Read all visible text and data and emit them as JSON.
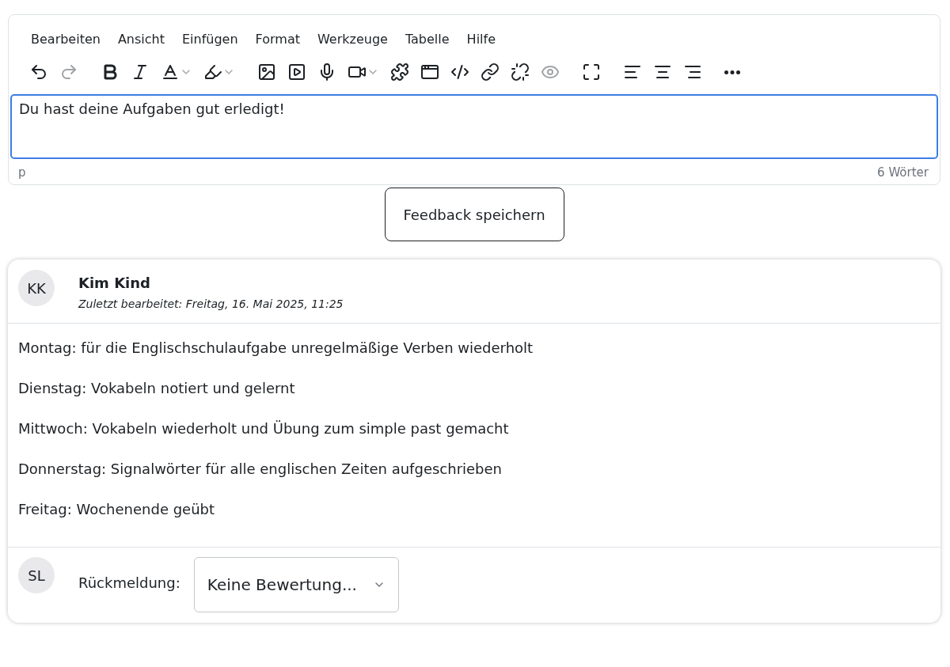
{
  "editor": {
    "menu": [
      "Bearbeiten",
      "Ansicht",
      "Einfügen",
      "Format",
      "Werkzeuge",
      "Tabelle",
      "Hilfe"
    ],
    "toolbar": [
      [
        {
          "kind": "undo",
          "disabled": false
        },
        {
          "kind": "redo",
          "disabled": true
        }
      ],
      [
        {
          "kind": "bold",
          "disabled": false
        },
        {
          "kind": "italic",
          "disabled": false
        },
        {
          "kind": "textcolor",
          "disabled": false
        },
        {
          "kind": "highlight",
          "disabled": false
        }
      ],
      [
        {
          "kind": "image",
          "disabled": false
        },
        {
          "kind": "media",
          "disabled": false
        },
        {
          "kind": "mic",
          "disabled": false
        },
        {
          "kind": "video",
          "disabled": false
        },
        {
          "kind": "plugin",
          "disabled": false
        },
        {
          "kind": "embed",
          "disabled": false
        },
        {
          "kind": "html",
          "disabled": false
        },
        {
          "kind": "link",
          "disabled": false
        },
        {
          "kind": "unlink",
          "disabled": false
        },
        {
          "kind": "preview",
          "disabled": true
        }
      ],
      [
        {
          "kind": "fullscreen",
          "disabled": false
        }
      ],
      [
        {
          "kind": "alignleft",
          "disabled": false
        },
        {
          "kind": "aligncenter",
          "disabled": false
        },
        {
          "kind": "alignright",
          "disabled": false
        }
      ],
      [
        {
          "kind": "more",
          "disabled": false
        }
      ]
    ],
    "content": "Du hast deine Aufgaben gut erledigt!",
    "path": "p",
    "word_count": "6 Wörter"
  },
  "save_button": "Feedback speichern",
  "submission": {
    "initials": "KK",
    "author": "Kim Kind",
    "edited": "Zuletzt bearbeitet: Freitag, 16. Mai 2025, 11:25",
    "lines": [
      "Montag: für die Englischschulaufgabe unregelmäßige Verben wiederholt",
      "Dienstag: Vokabeln notiert und gelernt",
      "Mittwoch: Vokabeln wiederholt und Übung zum simple past gemacht",
      "Donnerstag: Signalwörter für alle englischen Zeiten aufgeschrieben",
      "Freitag: Wochenende geübt"
    ],
    "feedback": {
      "initials": "SL",
      "label": "Rückmeldung:",
      "value": "Keine Bewertung..."
    }
  }
}
